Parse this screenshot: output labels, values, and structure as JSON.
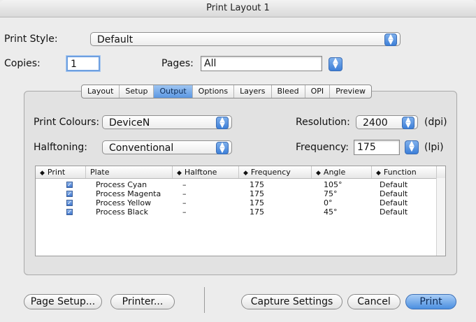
{
  "window": {
    "title": "Print Layout 1"
  },
  "print_style": {
    "label": "Print Style:",
    "value": "Default"
  },
  "copies": {
    "label": "Copies:",
    "value": "1"
  },
  "pages": {
    "label": "Pages:",
    "value": "All"
  },
  "tabs": [
    {
      "label": "Layout",
      "active": false
    },
    {
      "label": "Setup",
      "active": false
    },
    {
      "label": "Output",
      "active": true
    },
    {
      "label": "Options",
      "active": false
    },
    {
      "label": "Layers",
      "active": false
    },
    {
      "label": "Bleed",
      "active": false
    },
    {
      "label": "OPI",
      "active": false
    },
    {
      "label": "Preview",
      "active": false
    }
  ],
  "print_colours": {
    "label": "Print Colours:",
    "value": "DeviceN"
  },
  "halftoning": {
    "label": "Halftoning:",
    "value": "Conventional"
  },
  "resolution": {
    "label": "Resolution:",
    "value": "2400",
    "unit": "(dpi)"
  },
  "frequency": {
    "label": "Frequency:",
    "value": "175",
    "unit": "(lpi)"
  },
  "table": {
    "columns": [
      "Print",
      "Plate",
      "Halftone",
      "Frequency",
      "Angle",
      "Function"
    ],
    "rows": [
      {
        "print": true,
        "plate": "Process Cyan",
        "halftone": "–",
        "frequency": "175",
        "angle": "105°",
        "function": "Default"
      },
      {
        "print": true,
        "plate": "Process Magenta",
        "halftone": "–",
        "frequency": "175",
        "angle": "75°",
        "function": "Default"
      },
      {
        "print": true,
        "plate": "Process Yellow",
        "halftone": "–",
        "frequency": "175",
        "angle": "0°",
        "function": "Default"
      },
      {
        "print": true,
        "plate": "Process Black",
        "halftone": "–",
        "frequency": "175",
        "angle": "45°",
        "function": "Default"
      }
    ]
  },
  "buttons": {
    "page_setup": "Page Setup...",
    "printer": "Printer...",
    "capture_settings": "Capture Settings",
    "cancel": "Cancel",
    "print": "Print"
  },
  "icons": {
    "popup_arrows": "up-down-arrows-icon",
    "checkbox": "checkmark-icon",
    "sort": "sort-arrows-icon"
  },
  "colors": {
    "accent": "#5b97e2",
    "window_bg": "#ececec",
    "panel_bg": "#e2e2e2"
  }
}
